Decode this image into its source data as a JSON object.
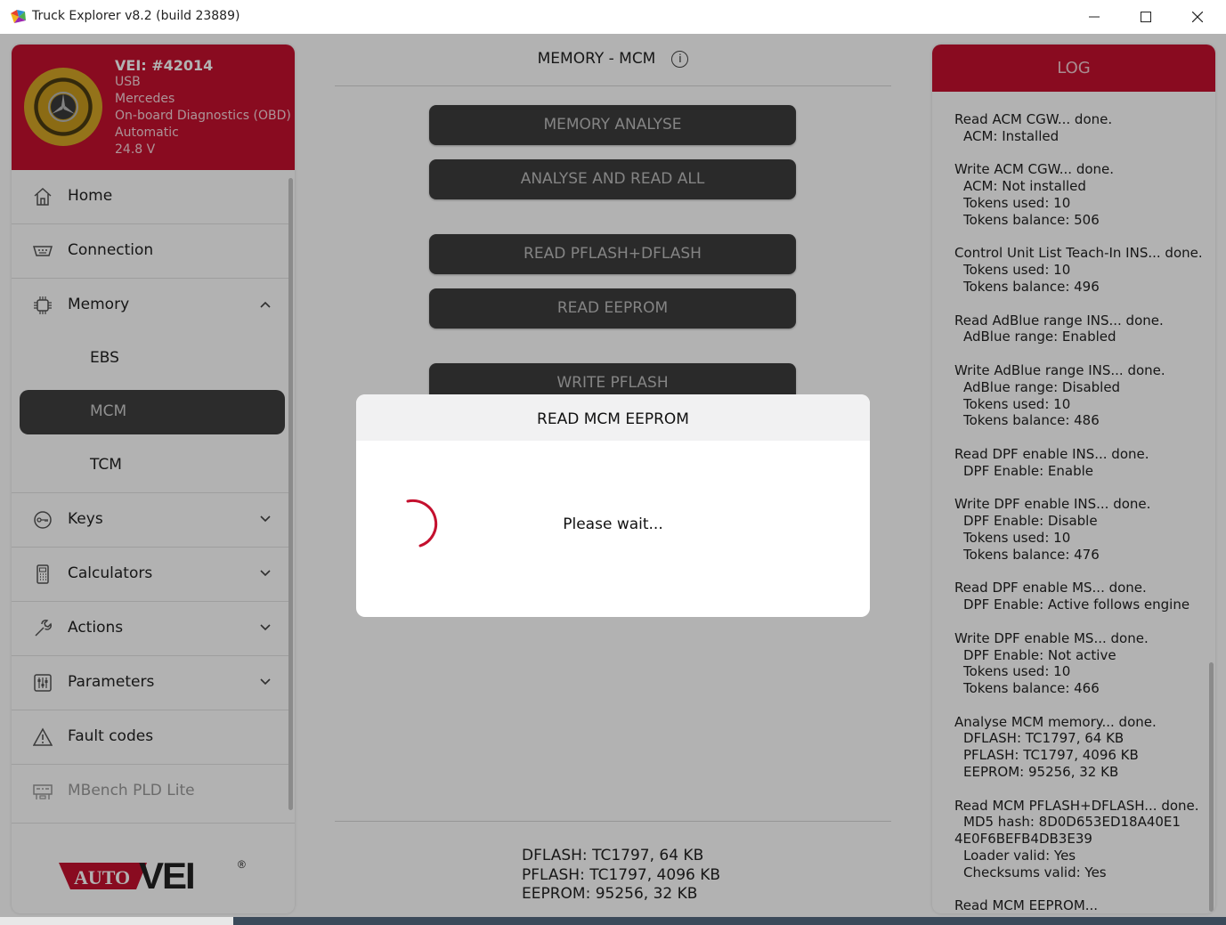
{
  "window": {
    "title": "Truck Explorer v8.2 (build 23889)"
  },
  "vehicle": {
    "id": "VEI: #42014",
    "interface": "USB",
    "brand": "Mercedes",
    "protocol": "On-board Diagnostics (OBD)",
    "mode": "Automatic",
    "voltage": "24.8 V"
  },
  "nav": {
    "items": [
      {
        "label": "Home",
        "icon": "home-icon"
      },
      {
        "label": "Connection",
        "icon": "connection-icon"
      },
      {
        "label": "Memory",
        "icon": "chip-icon",
        "expanded": true
      },
      {
        "label": "Keys",
        "icon": "key-icon"
      },
      {
        "label": "Calculators",
        "icon": "calculator-icon"
      },
      {
        "label": "Actions",
        "icon": "tools-icon"
      },
      {
        "label": "Parameters",
        "icon": "sliders-icon"
      },
      {
        "label": "Fault codes",
        "icon": "warning-icon"
      },
      {
        "label": "MBench PLD Lite",
        "icon": "bench-icon",
        "disabled": true
      }
    ],
    "memory_sub": [
      "EBS",
      "MCM",
      "TCM"
    ],
    "active_sub": "MCM"
  },
  "brand_logo": {
    "text_auto": "AUTO",
    "text_vei": "VEI",
    "reg": "®"
  },
  "main": {
    "title": "MEMORY - MCM",
    "info_icon": "i",
    "buttons": {
      "memory_analyse": "MEMORY ANALYSE",
      "analyse_read_all": "ANALYSE AND READ ALL",
      "read_pflash_dflash": "READ PFLASH+DFLASH",
      "read_eeprom": "READ EEPROM",
      "write_pflash": "WRITE PFLASH"
    },
    "summary": {
      "dflash": "DFLASH: TC1797, 64 KB",
      "pflash": "PFLASH: TC1797, 4096 KB",
      "eeprom": "EEPROM: 95256, 32 KB"
    }
  },
  "log": {
    "title": "LOG",
    "entries": [
      {
        "head": "Read ACM CGW... done.",
        "details": [
          "ACM: Installed"
        ]
      },
      {
        "head": "Write ACM CGW... done.",
        "details": [
          "ACM: Not installed",
          "Tokens used: 10",
          "Tokens balance: 506"
        ]
      },
      {
        "head": "Control Unit List Teach-In INS... done.",
        "details": [
          "Tokens used: 10",
          "Tokens balance: 496"
        ]
      },
      {
        "head": "Read AdBlue range INS... done.",
        "details": [
          "AdBlue range: Enabled"
        ]
      },
      {
        "head": "Write AdBlue range INS... done.",
        "details": [
          "AdBlue range: Disabled",
          "Tokens used: 10",
          "Tokens balance: 486"
        ]
      },
      {
        "head": "Read DPF enable INS... done.",
        "details": [
          "DPF Enable: Enable"
        ]
      },
      {
        "head": "Write DPF enable INS... done.",
        "details": [
          "DPF Enable: Disable",
          "Tokens used: 10",
          "Tokens balance: 476"
        ]
      },
      {
        "head": "Read DPF enable MS... done.",
        "details": [
          "DPF Enable: Active follows engine"
        ]
      },
      {
        "head": "Write DPF enable MS... done.",
        "details": [
          "DPF Enable: Not active",
          "Tokens used: 10",
          "Tokens balance: 466"
        ]
      },
      {
        "head": "Analyse MCM memory... done.",
        "details": [
          "DFLASH: TC1797, 64 KB",
          "PFLASH: TC1797, 4096 KB",
          "EEPROM: 95256, 32 KB"
        ]
      },
      {
        "head": "Read MCM PFLASH+DFLASH... done.",
        "details": [
          "MD5 hash: 8D0D653ED18A40E1"
        ],
        "cont": "4E0F6BEFB4DB3E39",
        "details2": [
          "Loader valid: Yes",
          "Checksums valid: Yes"
        ]
      },
      {
        "head": "Read MCM EEPROM...",
        "details": []
      }
    ]
  },
  "modal": {
    "title": "READ MCM EEPROM",
    "message": "Please wait..."
  },
  "colors": {
    "brand_red": "#c4102e",
    "button_dark": "#3d3d3d",
    "spinner": "#c4102e"
  }
}
